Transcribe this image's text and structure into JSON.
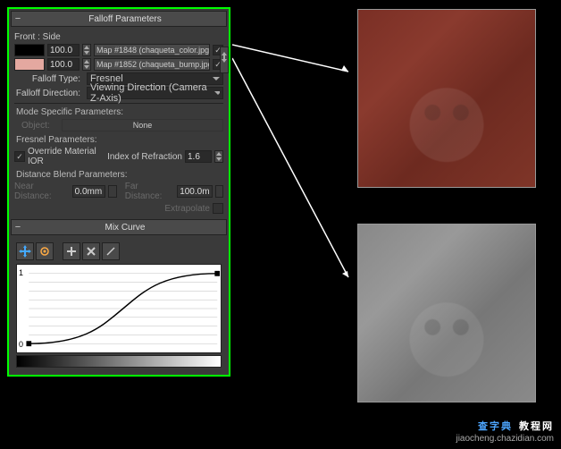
{
  "rollups": {
    "falloff": "Falloff Parameters",
    "mix": "Mix Curve"
  },
  "frontSide": "Front : Side",
  "slot1": {
    "amount": "100.0",
    "map": "Map #1848 (chaqueta_color.jpg)"
  },
  "slot2": {
    "amount": "100.0",
    "map": "Map #1852 (chaqueta_bump.jpg)"
  },
  "falloffType": {
    "label": "Falloff Type:",
    "value": "Fresnel"
  },
  "falloffDir": {
    "label": "Falloff Direction:",
    "value": "Viewing Direction (Camera Z-Axis)"
  },
  "modeSpecific": "Mode Specific Parameters:",
  "objectLbl": "Object:",
  "objectBtn": "None",
  "fresnelParams": "Fresnel Parameters:",
  "overrideIOR": "Override Material IOR",
  "ior": {
    "label": "Index of Refraction",
    "value": "1.6"
  },
  "distBlend": "Distance Blend Parameters:",
  "nearDist": {
    "label": "Near Distance:",
    "value": "0.0mm"
  },
  "farDist": {
    "label": "Far Distance:",
    "value": "100.0m"
  },
  "extrapolate": "Extrapolate",
  "curve": {
    "yMax": "1",
    "yMin": "0"
  },
  "watermark": {
    "cn1": "查字典",
    "cn2": "教程网",
    "url": "jiaocheng.chazidian.com"
  }
}
